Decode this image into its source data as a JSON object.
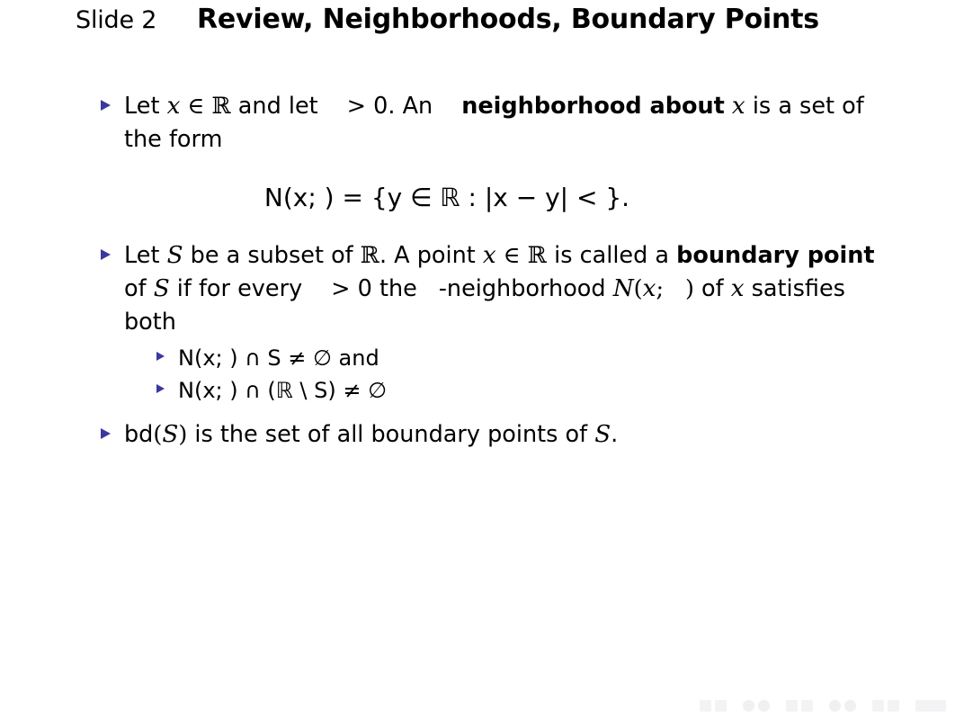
{
  "slide": {
    "title_prefix": "Slide 2",
    "title_main": "Review, Neighborhoods, Boundary Points",
    "bullet_color": "#3a38a0",
    "background": "#ffffff",
    "text_color": "#000000"
  },
  "bullets": [
    {
      "id": "neighborhood-definition",
      "segments": [
        {
          "text": "Let "
        },
        {
          "text": "x",
          "style": "math-italic"
        },
        {
          "text": " ",
          "style": "plain"
        },
        {
          "text": "∈",
          "style": "math-op"
        },
        {
          "text": " "
        },
        {
          "text": "ℝ",
          "style": "blackboard"
        },
        {
          "text": " and let "
        },
        {
          "text": "",
          "style": "missing-epsilon"
        },
        {
          "text": " "
        },
        {
          "text": ">",
          "style": "math-op"
        },
        {
          "text": " 0. An "
        },
        {
          "text": "",
          "style": "missing-epsilon"
        },
        {
          "text": " "
        },
        {
          "text": "neighborhood about",
          "style": "bold"
        },
        {
          "text": " "
        },
        {
          "text": "x",
          "style": "math-italic"
        },
        {
          "text": " is a set of the form"
        }
      ]
    },
    {
      "id": "boundary-point-definition",
      "segments": [
        {
          "text": "Let "
        },
        {
          "text": "S",
          "style": "math-italic"
        },
        {
          "text": " be a subset of "
        },
        {
          "text": "ℝ",
          "style": "blackboard"
        },
        {
          "text": ". A point "
        },
        {
          "text": "x",
          "style": "math-italic"
        },
        {
          "text": " "
        },
        {
          "text": "∈",
          "style": "math-op"
        },
        {
          "text": " "
        },
        {
          "text": "ℝ",
          "style": "blackboard"
        },
        {
          "text": " is called a "
        },
        {
          "text": "boundary point",
          "style": "bold"
        },
        {
          "text": " of "
        },
        {
          "text": "S",
          "style": "math-italic"
        },
        {
          "text": " if for every "
        },
        {
          "text": "",
          "style": "missing-epsilon"
        },
        {
          "text": " "
        },
        {
          "text": ">",
          "style": "math-op"
        },
        {
          "text": " 0 the "
        },
        {
          "text": "",
          "style": "missing-epsilon"
        },
        {
          "text": "-neighborhood "
        },
        {
          "text": "N",
          "style": "math-italic"
        },
        {
          "text": "(",
          "style": "math-op"
        },
        {
          "text": "x",
          "style": "math-italic"
        },
        {
          "text": "; ",
          "style": "math-op"
        },
        {
          "text": "",
          "style": "missing-epsilon"
        },
        {
          "text": ")",
          "style": "math-op"
        },
        {
          "text": " of "
        },
        {
          "text": "x",
          "style": "math-italic"
        },
        {
          "text": " satisfies both"
        }
      ]
    },
    {
      "id": "bd-set-definition",
      "segments": [
        {
          "text": "bd",
          "style": "plain"
        },
        {
          "text": "(",
          "style": "math-op"
        },
        {
          "text": "S",
          "style": "math-italic"
        },
        {
          "text": ")",
          "style": "math-op"
        },
        {
          "text": " is the set of all boundary points of "
        },
        {
          "text": "S",
          "style": "math-italic"
        },
        {
          "text": "."
        }
      ]
    }
  ],
  "sub_bullets": [
    {
      "id": "condition-intersect-S",
      "text": "N(x; ) ∩ S ≠ ∅ and"
    },
    {
      "id": "condition-intersect-complement",
      "text": "N(x; ) ∩ (ℝ \\ S) ≠ ∅"
    }
  ],
  "display_equation": {
    "id": "neighborhood-set-builder",
    "text": "N(x; ) = {y ∈ ℝ : |x − y| < }."
  },
  "navigation": {
    "label": "beamer-navigation-symbols",
    "items": [
      "slide-previous-icon",
      "slide-next-icon",
      "frame-previous-icon",
      "frame-next-icon",
      "subsection-previous-icon",
      "subsection-next-icon",
      "section-previous-icon",
      "section-next-icon",
      "presentation-start-icon",
      "presentation-end-icon",
      "back-icon",
      "forward-icon"
    ]
  }
}
